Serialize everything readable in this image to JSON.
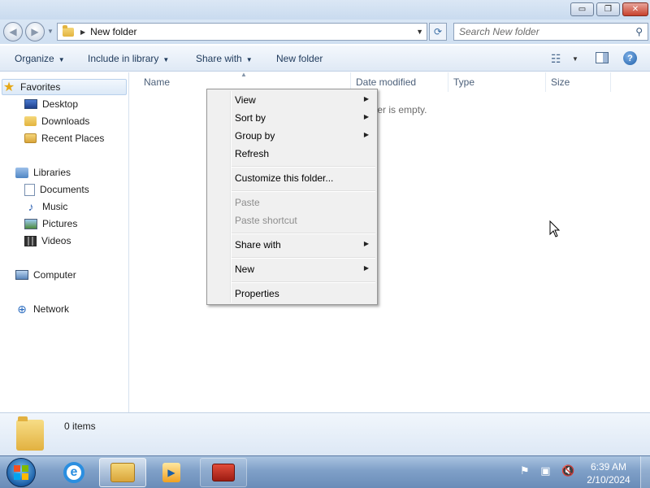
{
  "window": {
    "controls": {
      "minimize": "▭",
      "maximize": "❐",
      "close": "✕"
    }
  },
  "address": {
    "crumb": "New folder",
    "search_placeholder": "Search New folder"
  },
  "commandbar": {
    "organize": "Organize",
    "include_in_library": "Include in library",
    "share_with": "Share with",
    "new_folder": "New folder"
  },
  "nav": {
    "favorites": "Favorites",
    "desktop": "Desktop",
    "downloads": "Downloads",
    "recent_places": "Recent Places",
    "libraries": "Libraries",
    "documents": "Documents",
    "music": "Music",
    "pictures": "Pictures",
    "videos": "Videos",
    "computer": "Computer",
    "network": "Network"
  },
  "columns": {
    "name": "Name",
    "date_modified": "Date modified",
    "type": "Type",
    "size": "Size"
  },
  "content": {
    "empty_message": "lder is empty."
  },
  "context_menu": {
    "view": "View",
    "sort_by": "Sort by",
    "group_by": "Group by",
    "refresh": "Refresh",
    "customize": "Customize this folder...",
    "paste": "Paste",
    "paste_shortcut": "Paste shortcut",
    "share_with": "Share with",
    "new": "New",
    "properties": "Properties"
  },
  "details": {
    "items_count": "0 items"
  },
  "taskbar": {
    "time": "6:39 AM",
    "date": "2/10/2024"
  },
  "colors": {
    "accent": "#1e395b",
    "selection_border": "#b8d0ec",
    "taskbar": "#7fa0c8"
  }
}
